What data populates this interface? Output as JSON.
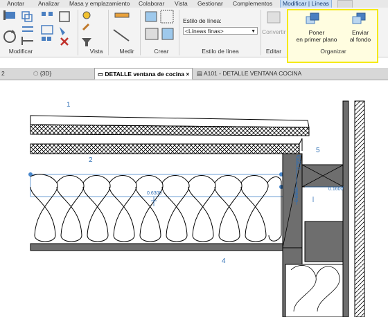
{
  "menu": {
    "items": [
      "Anotar",
      "Analizar",
      "Masa y emplazamiento",
      "Colaborar",
      "Vista",
      "Gestionar",
      "Complementos",
      "Modificar | Líneas"
    ],
    "active": "Modificar | Líneas"
  },
  "ribbon": {
    "panels": {
      "modify": "Modificar",
      "view": "Vista",
      "measure": "Medir",
      "create": "Crear",
      "line_style": "Estilo de línea",
      "edit": "Editar",
      "organize": "Organizar"
    },
    "line_style_label": "Estilo de línea:",
    "line_style_value": "<Líneas finas>",
    "convert_lines": "Convertir líneas",
    "bring_to_front_l1": "Poner",
    "bring_to_front_l2": "en primer plano",
    "send_to_back_l1": "Enviar",
    "send_to_back_l2": "al fondo"
  },
  "tabs": {
    "tab1": "2",
    "tab2": "{3D}",
    "tab3": "DETALLE ventana de cocina",
    "tab3_close": "×",
    "tab4": "A101 - DETALLE VENTANA COCINA"
  },
  "drawing": {
    "callouts": [
      "1",
      "2",
      "4",
      "5"
    ],
    "dims": [
      "0.6300",
      "0.0550",
      "0.0550",
      "0.1600"
    ]
  },
  "colors": {
    "highlight": "#f5ea17",
    "selection": "#2f6fb5",
    "concrete": "#6e6e6e"
  }
}
